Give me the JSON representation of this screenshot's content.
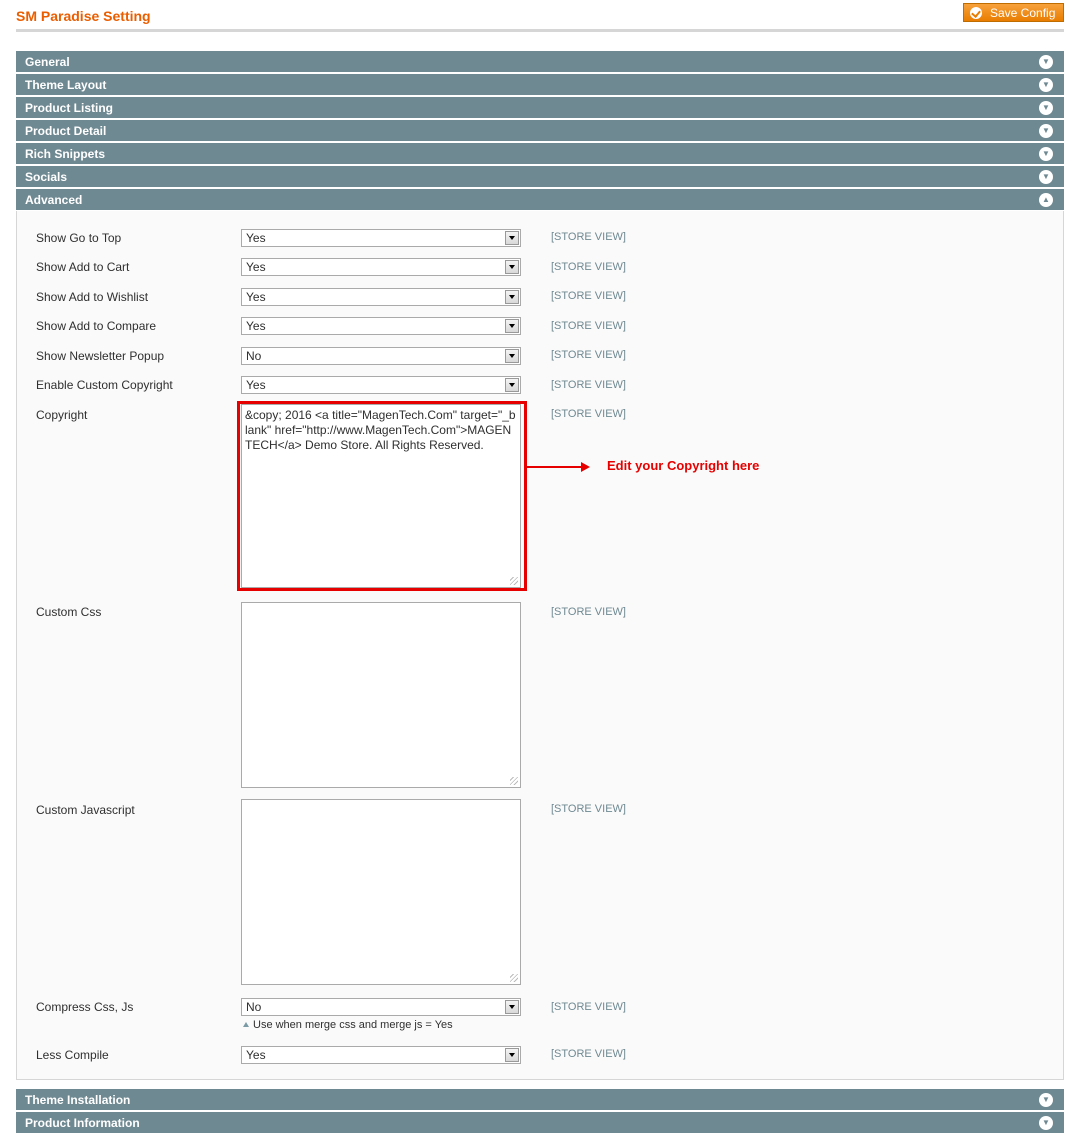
{
  "header": {
    "title": "SM Paradise Setting",
    "save_label": "Save Config"
  },
  "sections_top": [
    {
      "label": "General",
      "state": "collapsed"
    },
    {
      "label": "Theme Layout",
      "state": "collapsed"
    },
    {
      "label": "Product Listing",
      "state": "collapsed"
    },
    {
      "label": "Product Detail",
      "state": "collapsed"
    },
    {
      "label": "Rich Snippets",
      "state": "collapsed"
    },
    {
      "label": "Socials",
      "state": "collapsed"
    },
    {
      "label": "Advanced",
      "state": "expanded"
    }
  ],
  "advanced": {
    "fields": [
      {
        "label": "Show Go to Top",
        "value": "Yes",
        "scope": "[STORE VIEW]"
      },
      {
        "label": "Show Add to Cart",
        "value": "Yes",
        "scope": "[STORE VIEW]"
      },
      {
        "label": "Show Add to Wishlist",
        "value": "Yes",
        "scope": "[STORE VIEW]"
      },
      {
        "label": "Show Add to Compare",
        "value": "Yes",
        "scope": "[STORE VIEW]"
      },
      {
        "label": "Show Newsletter Popup",
        "value": "No",
        "scope": "[STORE VIEW]"
      },
      {
        "label": "Enable Custom Copyright",
        "value": "Yes",
        "scope": "[STORE VIEW]"
      },
      {
        "label": "Copyright",
        "value": "&copy; 2016 <a title=\"MagenTech.Com\" target=\"_blank\" href=\"http://www.MagenTech.Com\">MAGENTECH</a> Demo Store. All Rights Reserved.",
        "scope": "[STORE VIEW]"
      },
      {
        "label": "Custom Css",
        "value": "",
        "scope": "[STORE VIEW]"
      },
      {
        "label": "Custom Javascript",
        "value": "",
        "scope": "[STORE VIEW]"
      },
      {
        "label": "Compress Css, Js",
        "value": "No",
        "scope": "[STORE VIEW]",
        "note": "Use when merge css and merge js = Yes"
      },
      {
        "label": "Less Compile",
        "value": "Yes",
        "scope": "[STORE VIEW]"
      }
    ]
  },
  "annotation": {
    "text": "Edit your Copyright here",
    "color": "#e60000"
  },
  "sections_bottom": [
    {
      "label": "Theme Installation",
      "state": "collapsed"
    },
    {
      "label": "Product Information",
      "state": "collapsed"
    }
  ],
  "colors": {
    "section_bar": "#6f8992",
    "title": "#eb5e00",
    "save_button": "#f18200"
  }
}
